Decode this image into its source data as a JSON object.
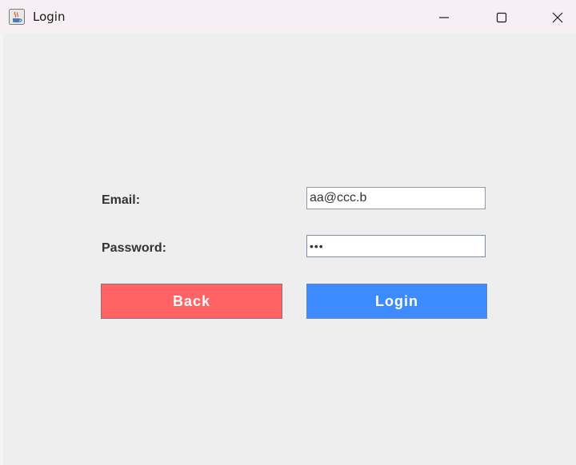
{
  "window": {
    "title": "Login",
    "app_icon": "java-coffee-cup-icon",
    "controls": {
      "minimize_icon": "minimize-icon",
      "maximize_icon": "maximize-icon",
      "close_icon": "close-icon"
    }
  },
  "form": {
    "email_label": "Email:",
    "email_value": "aa@ccc.b",
    "password_label": "Password:",
    "password_value": "•••"
  },
  "buttons": {
    "back_label": "Back",
    "login_label": "Login"
  },
  "colors": {
    "back_button": "#ff6363",
    "login_button": "#3d8bff",
    "background": "#eeeeee",
    "titlebar": "#f6eff3"
  }
}
